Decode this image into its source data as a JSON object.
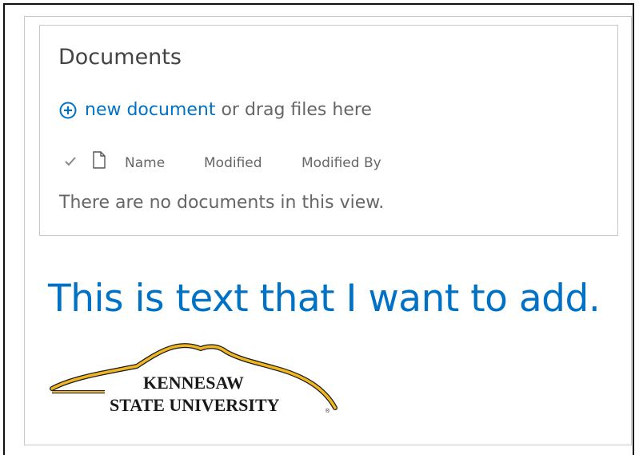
{
  "documents_webpart": {
    "title": "Documents",
    "new_document_link": "new document",
    "new_document_suffix": " or drag files here",
    "columns": {
      "name": "Name",
      "modified": "Modified",
      "modified_by": "Modified By"
    },
    "empty_message": "There are no documents in this view."
  },
  "content": {
    "body_text": "This is text that I want to add."
  },
  "logo": {
    "line1": "KENNESAW",
    "line2": "STATE UNIVERSITY",
    "brand_gold": "#f0b622",
    "brand_dark": "#1a1a1a"
  },
  "colors": {
    "link_blue": "#0072c6",
    "text_gray": "#666666",
    "border_gray": "#c8c8c8"
  },
  "icons": {
    "add": "plus-circle-icon",
    "select": "checkmark-icon",
    "type": "document-icon"
  }
}
